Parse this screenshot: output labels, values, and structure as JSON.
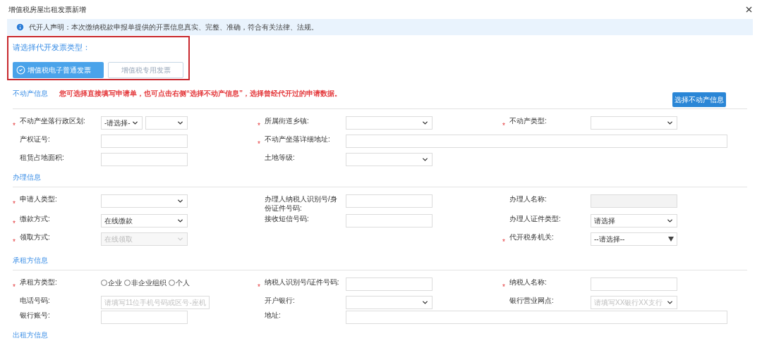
{
  "window": {
    "title": "增值税房屋出租发票新增"
  },
  "notice": "代开人声明：本次缴纳税款申报单提供的开票信息真实、完整、准确，符合有关法律、法规。",
  "invoice_type": {
    "prompt": "请选择代开发票类型：",
    "highlighted": true,
    "options": [
      {
        "label": "增值税电子普通发票",
        "selected": true
      },
      {
        "label": "增值税专用发票",
        "selected": false
      }
    ]
  },
  "sections": [
    {
      "title": "不动产信息",
      "note": "您可选择直接填写申请单，也可点击右侧“选择不动产信息”，选择曾经代开过的申请数据。",
      "action": "选择不动产信息",
      "rows": [
        [
          {
            "kind": "double-select",
            "label": "不动产坐落行政区划:",
            "mark": "*",
            "value": "-请选择-"
          },
          {
            "kind": "select",
            "label": "所属街道乡镇:",
            "mark": "*"
          },
          {
            "kind": "select",
            "label": "不动产类型:",
            "mark": "*"
          }
        ],
        [
          {
            "kind": "input",
            "label": "产权证号:"
          },
          {
            "kind": "wide-input",
            "label": "不动产坐落详细地址:",
            "mark": "*"
          }
        ],
        [
          {
            "kind": "input",
            "label": "租赁占地面积:"
          },
          {
            "kind": "select",
            "label": "土地等级:"
          }
        ]
      ]
    },
    {
      "title": "办理信息",
      "rows": [
        [
          {
            "kind": "select",
            "label": "申请人类型:",
            "mark": "*"
          },
          {
            "kind": "input",
            "label": "办理人纳税人识别号/身份证件号码:"
          },
          {
            "kind": "input",
            "label": "办理人名称:",
            "disabled": true
          }
        ],
        [
          {
            "kind": "select",
            "label": "缴款方式:",
            "mark": "*",
            "value": "在线缴款"
          },
          {
            "kind": "input",
            "label": "接收短信号码:"
          },
          {
            "kind": "select",
            "label": "办理人证件类型:",
            "value": "请选择"
          }
        ],
        [
          {
            "kind": "select",
            "label": "领取方式:",
            "mark": "*",
            "value": "在线领取",
            "disabled": true
          },
          {
            "kind": "blank"
          },
          {
            "kind": "combo",
            "label": "代开税务机关:",
            "mark": "*",
            "value": "--请选择--"
          }
        ]
      ]
    },
    {
      "title": "承租方信息",
      "rows": [
        [
          {
            "kind": "radio",
            "label": "承租方类型:",
            "mark": "*",
            "options": [
              {
                "label": "企业",
                "selected": false
              },
              {
                "label": "非企业组织",
                "selected": false
              },
              {
                "label": "个人",
                "selected": false
              }
            ]
          },
          {
            "kind": "input",
            "label": "纳税人识别号/证件号码:",
            "mark": "*"
          },
          {
            "kind": "input",
            "label": "纳税人名称:",
            "mark": "*"
          }
        ],
        [
          {
            "kind": "input",
            "label": "电话号码:",
            "placeholder": "请填写11位手机号码或区号-座机"
          },
          {
            "kind": "select",
            "label": "开户银行:"
          },
          {
            "kind": "select",
            "label": "银行营业网点:",
            "placeholder": "请填写XX银行XX支行"
          }
        ],
        [
          {
            "kind": "input",
            "label": "银行账号:"
          },
          {
            "kind": "wide-input",
            "label": "地址:"
          }
        ]
      ]
    },
    {
      "title": "出租方信息"
    }
  ]
}
